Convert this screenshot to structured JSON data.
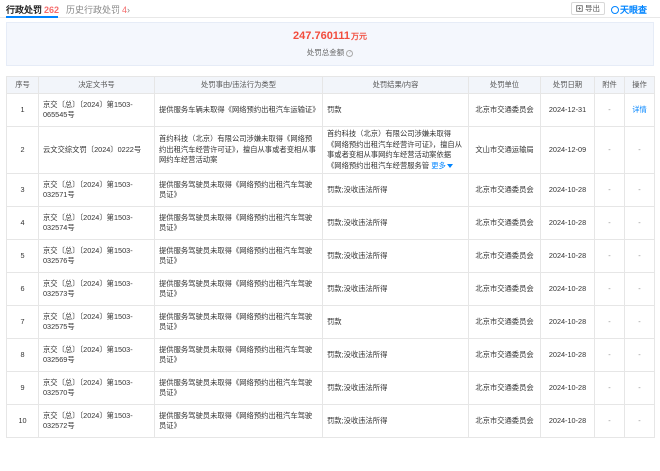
{
  "tabs": {
    "main_label": "行政处罚",
    "main_count": "262",
    "history_label": "历史行政处罚",
    "history_count": "4"
  },
  "toolbar": {
    "export_label": "导出",
    "logo_text": "天眼查"
  },
  "summary": {
    "amount": "247.760111",
    "unit": "万元",
    "label": "处罚总金额"
  },
  "table": {
    "headers": [
      "序号",
      "决定文书号",
      "处罚事由/违法行为类型",
      "处罚结果/内容",
      "处罚单位",
      "处罚日期",
      "附件",
      "操作"
    ],
    "rows": [
      {
        "no": "1",
        "doc": "京交〔总〕〔2024〕第1503-065545号",
        "reason": "提供服务车辆未取得《网络预约出租汽车运输证》",
        "result": "罚款",
        "unit": "北京市交通委员会",
        "date": "2024-12-31",
        "attach": "-",
        "action": "详情"
      },
      {
        "no": "2",
        "doc": "云文交综文罚〔2024〕0222号",
        "reason": "首约科技（北京）有限公司涉嫌未取得《网络预约出租汽车经营许可证》，擅自从事或者变相从事网约车经营活动案",
        "result": "首约科技（北京）有限公司涉嫌未取得《网络预约出租汽车经营许可证》，擅自从事或者变相从事网约车经营活动案依据《网络预约出租汽车经营服务管",
        "more": "更多",
        "unit": "文山市交通运输局",
        "date": "2024-12-09",
        "attach": "-",
        "action": "-"
      },
      {
        "no": "3",
        "doc": "京交〔总〕〔2024〕第1503-032571号",
        "reason": "提供服务驾驶员未取得《网络预约出租汽车驾驶员证》",
        "result": "罚款;没收违法所得",
        "unit": "北京市交通委员会",
        "date": "2024-10-28",
        "attach": "-",
        "action": "-"
      },
      {
        "no": "4",
        "doc": "京交〔总〕〔2024〕第1503-032574号",
        "reason": "提供服务驾驶员未取得《网络预约出租汽车驾驶员证》",
        "result": "罚款;没收违法所得",
        "unit": "北京市交通委员会",
        "date": "2024-10-28",
        "attach": "-",
        "action": "-"
      },
      {
        "no": "5",
        "doc": "京交〔总〕〔2024〕第1503-032576号",
        "reason": "提供服务驾驶员未取得《网络预约出租汽车驾驶员证》",
        "result": "罚款;没收违法所得",
        "unit": "北京市交通委员会",
        "date": "2024-10-28",
        "attach": "-",
        "action": "-"
      },
      {
        "no": "6",
        "doc": "京交〔总〕〔2024〕第1503-032573号",
        "reason": "提供服务驾驶员未取得《网络预约出租汽车驾驶员证》",
        "result": "罚款;没收违法所得",
        "unit": "北京市交通委员会",
        "date": "2024-10-28",
        "attach": "-",
        "action": "-"
      },
      {
        "no": "7",
        "doc": "京交〔总〕〔2024〕第1503-032575号",
        "reason": "提供服务驾驶员未取得《网络预约出租汽车驾驶员证》",
        "result": "罚款",
        "unit": "北京市交通委员会",
        "date": "2024-10-28",
        "attach": "-",
        "action": "-"
      },
      {
        "no": "8",
        "doc": "京交〔总〕〔2024〕第1503-032569号",
        "reason": "提供服务驾驶员未取得《网络预约出租汽车驾驶员证》",
        "result": "罚款;没收违法所得",
        "unit": "北京市交通委员会",
        "date": "2024-10-28",
        "attach": "-",
        "action": "-"
      },
      {
        "no": "9",
        "doc": "京交〔总〕〔2024〕第1503-032570号",
        "reason": "提供服务驾驶员未取得《网络预约出租汽车驾驶员证》",
        "result": "罚款;没收违法所得",
        "unit": "北京市交通委员会",
        "date": "2024-10-28",
        "attach": "-",
        "action": "-"
      },
      {
        "no": "10",
        "doc": "京交〔总〕〔2024〕第1503-032572号",
        "reason": "提供服务驾驶员未取得《网络预约出租汽车驾驶员证》",
        "result": "罚款;没收违法所得",
        "unit": "北京市交通委员会",
        "date": "2024-10-28",
        "attach": "-",
        "action": "-"
      }
    ]
  }
}
